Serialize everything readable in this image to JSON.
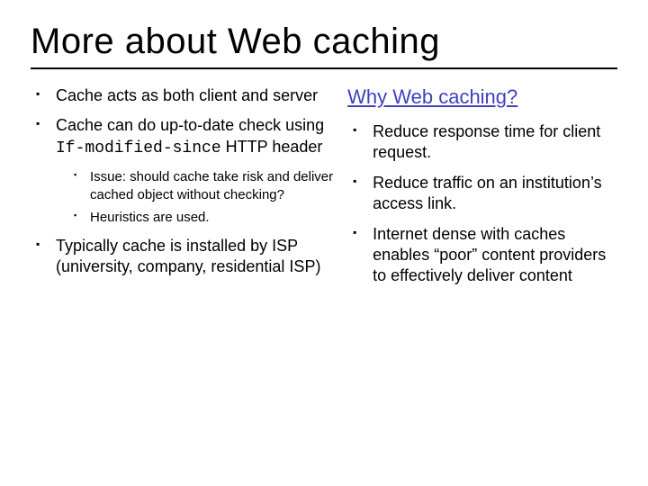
{
  "title": "More about Web caching",
  "left": {
    "items": [
      {
        "text": "Cache acts as both client and server"
      },
      {
        "prefix": "Cache can do up-to-date check using ",
        "code": "If-modified-since",
        "suffix": " HTTP header"
      }
    ],
    "sub": [
      "Issue: should cache take risk and deliver cached object without checking?",
      "Heuristics are used."
    ],
    "tail": [
      "Typically cache is installed by ISP (university, company, residential ISP)"
    ]
  },
  "right": {
    "heading": "Why Web caching?",
    "items": [
      "Reduce response time for client request.",
      "Reduce traffic on an institution’s access link.",
      "Internet dense with caches enables “poor” content providers to effectively deliver content"
    ]
  }
}
